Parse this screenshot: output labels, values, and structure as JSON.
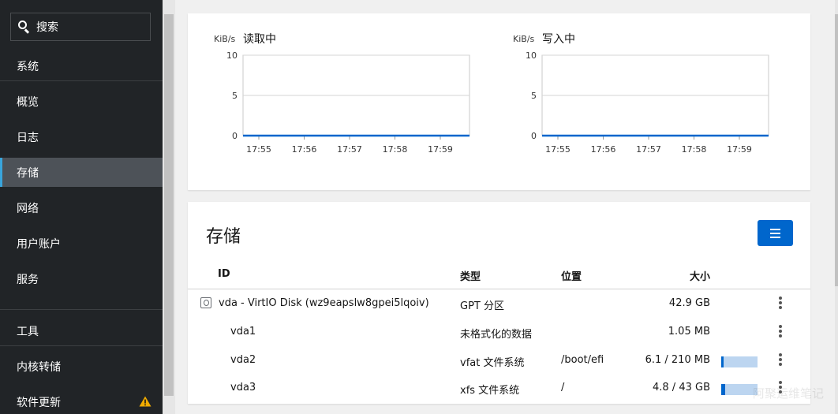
{
  "sidebar": {
    "search_label": "搜索",
    "items": [
      {
        "label": "系统"
      },
      {
        "label": "概览"
      },
      {
        "label": "日志"
      },
      {
        "label": "存储"
      },
      {
        "label": "网络"
      },
      {
        "label": "用户账户"
      },
      {
        "label": "服务"
      },
      {
        "label": "工具"
      },
      {
        "label": "内核转储"
      },
      {
        "label": "软件更新"
      }
    ],
    "active_item": "存储",
    "warning_color": "#f0ab00"
  },
  "charts": {
    "read": {
      "title": "读取中",
      "unit": "KiB/s"
    },
    "write": {
      "title": "写入中",
      "unit": "KiB/s"
    }
  },
  "chart_data": [
    {
      "type": "line",
      "title": "读取中",
      "ylabel": "KiB/s",
      "x": [
        "17:55",
        "17:56",
        "17:57",
        "17:58",
        "17:59"
      ],
      "y_ticks": [
        0,
        5,
        10
      ],
      "ylim": [
        0,
        10
      ],
      "series": [
        {
          "values": [
            0,
            0,
            0,
            0,
            0,
            0
          ]
        }
      ],
      "color": "#0066cc",
      "grid": true
    },
    {
      "type": "line",
      "title": "写入中",
      "ylabel": "KiB/s",
      "x": [
        "17:55",
        "17:56",
        "17:57",
        "17:58",
        "17:59"
      ],
      "y_ticks": [
        0,
        5,
        10
      ],
      "ylim": [
        0,
        10
      ],
      "series": [
        {
          "values": [
            0,
            0,
            0,
            0,
            0,
            0
          ]
        }
      ],
      "color": "#0066cc",
      "grid": true
    }
  ],
  "storage": {
    "title": "存储",
    "columns": {
      "id": "ID",
      "type": "类型",
      "location": "位置",
      "size": "大小"
    },
    "rows": [
      {
        "id": "vda - VirtIO Disk (wz9eapslw8gpei5lqoiv)",
        "type": "GPT 分区",
        "location": "",
        "size": "42.9 GB",
        "usage": null
      },
      {
        "id": "vda1",
        "type": "未格式化的数据",
        "location": "",
        "size": "1.05 MB",
        "usage": null
      },
      {
        "id": "vda2",
        "type": "vfat 文件系统",
        "location": "/boot/efi",
        "size": "6.1 / 210 MB",
        "usage": 0.029
      },
      {
        "id": "vda3",
        "type": "xfs 文件系统",
        "location": "/",
        "size": "4.8 / 43 GB",
        "usage": 0.112
      }
    ]
  },
  "watermark": "阿聚运维笔记"
}
